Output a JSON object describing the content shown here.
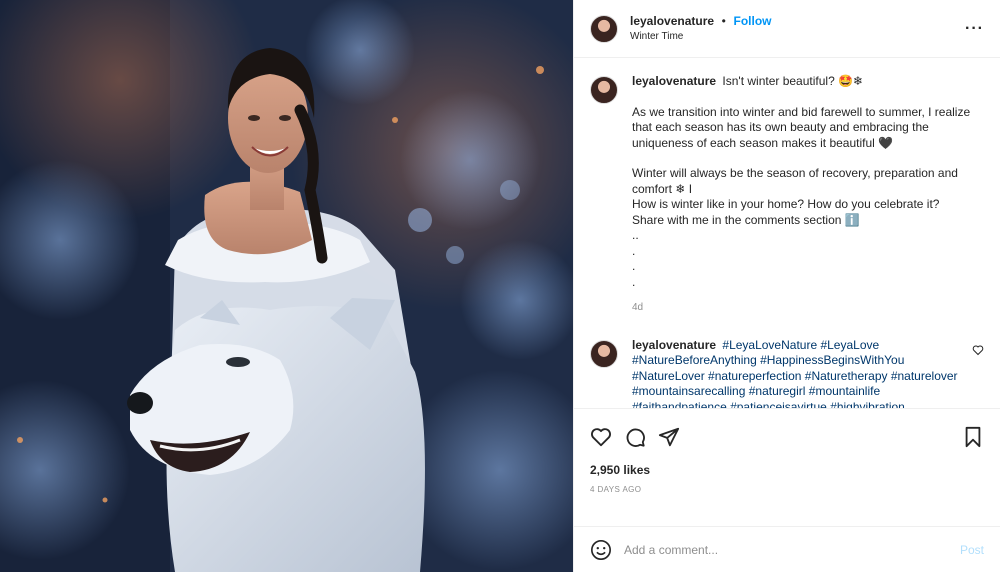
{
  "header": {
    "username": "leyalovenature",
    "separator": "•",
    "follow_label": "Follow",
    "location": "Winter Time",
    "more_icon": "···"
  },
  "caption": {
    "username": "leyalovenature",
    "first_line": "Isn't winter beautiful? 🤩❄",
    "para1": "As we transition into winter and bid farewell to summer, I realize that each season has its own beauty and embracing the uniqueness of each season makes it beautiful 🖤",
    "para2": "Winter will always be the season of recovery, preparation and comfort ❄ I",
    "para3": "How is winter like in your home? How do you celebrate it? Share with me in the comments section ℹ️",
    "dots": [
      "..",
      ".",
      ".",
      "."
    ],
    "age": "4d"
  },
  "comment": {
    "username": "leyalovenature",
    "tags": "#LeyaLoveNature #LeyaLove #NatureBeforeAnything #HappinessBeginsWithYou #NatureLover #natureperfection #Naturetherapy #naturelover #mountainsarecalling #naturegirl #mountainlife #faithandpatience #patienceisavirtue #highvibration #nftartistsoninstagram #nftcollectors #nftartists #nftart"
  },
  "actions": {
    "icons": [
      "heart-icon",
      "comment-icon",
      "share-icon",
      "bookmark-icon"
    ],
    "likes": "2,950 likes",
    "date": "4 DAYS AGO"
  },
  "add_comment": {
    "placeholder": "Add a comment...",
    "post_label": "Post"
  },
  "colors": {
    "link": "#0095f6",
    "hashtag": "#00376b",
    "muted": "#8e8e8e"
  }
}
